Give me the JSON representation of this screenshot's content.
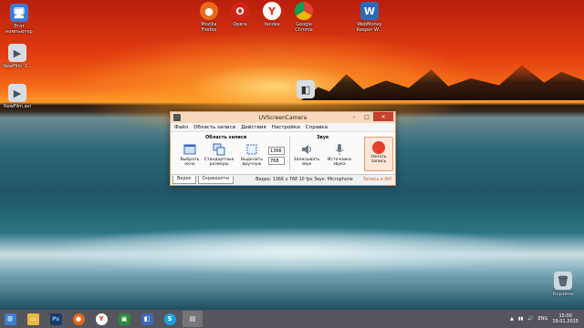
{
  "desktop": {
    "left_icons": [
      {
        "label": "Этот\nкомпьютер",
        "icon": "computer-icon"
      },
      {
        "label": "NewFilm_1...",
        "icon": "video-file-icon"
      },
      {
        "label": "NewFilm.avi",
        "icon": "video-file-icon"
      }
    ],
    "top_icons": [
      {
        "label": "Mozilla\nFirefox",
        "icon": "firefox-icon",
        "color": "#e66a1a"
      },
      {
        "label": "Opera",
        "icon": "opera-icon",
        "color": "#d3251b"
      },
      {
        "label": "Yandex",
        "icon": "yandex-icon",
        "color": "#e02a1a"
      },
      {
        "label": "Google\nChrome",
        "icon": "chrome-icon",
        "color": "#2a9d3a"
      },
      {
        "label": "WebMoney\nKeeper W...",
        "icon": "webmoney-icon",
        "color": "#2c6ab8"
      }
    ],
    "recycle_bin": "Корзина",
    "uvscreen_shortcut_icon": "uvscreencamera-icon"
  },
  "window": {
    "title": "UVScreenCamera",
    "controls": {
      "minimize": "–",
      "maximize": "□",
      "close": "✕"
    },
    "menu": [
      "Файл",
      "Область записи",
      "Действия",
      "Настройки",
      "Справка"
    ],
    "groups": {
      "area": "Область записи",
      "sound": "Звук"
    },
    "tools": {
      "select_window": "Выбрать\nокно",
      "standard_sizes": "Стандартные\nразмеры",
      "select_manually": "Выделить\nвручную",
      "record_sound": "Записывать\nзвук",
      "sound_sources": "Источники\nзвука",
      "start_record": "Начать\nзапись"
    },
    "width_value": "1366",
    "height_value": "768",
    "tabs": [
      "Видео",
      "Скриншоты"
    ],
    "status": "Видео: 1366 x 768 10 fps  Звук: Microphone",
    "record_format": "Запись в AVI",
    "accent": "#e8402c"
  },
  "taskbar": {
    "apps": [
      {
        "icon": "start-icon",
        "glyph": "⊞",
        "color": "#3c7fd0"
      },
      {
        "icon": "file-explorer-icon",
        "glyph": "▭",
        "color": "#e8b840"
      },
      {
        "icon": "photoshop-icon",
        "glyph": "Ps",
        "color": "#1b3b6a"
      },
      {
        "icon": "firefox-icon",
        "glyph": "●",
        "color": "#e66a1a"
      },
      {
        "icon": "yandex-icon",
        "glyph": "Y",
        "color": "#e02a1a"
      },
      {
        "icon": "camtasia-icon",
        "glyph": "▣",
        "color": "#2a8a3a"
      },
      {
        "icon": "uvscreencamera-icon",
        "glyph": "◧",
        "color": "#3a6ab8"
      },
      {
        "icon": "skype-icon",
        "glyph": "S",
        "color": "#1aa0e0"
      },
      {
        "icon": "uvscreencamera-running-icon",
        "glyph": "▤",
        "color": "#777777"
      }
    ],
    "lang": "ENG",
    "time": "15:00",
    "date": "19.01.2015"
  }
}
